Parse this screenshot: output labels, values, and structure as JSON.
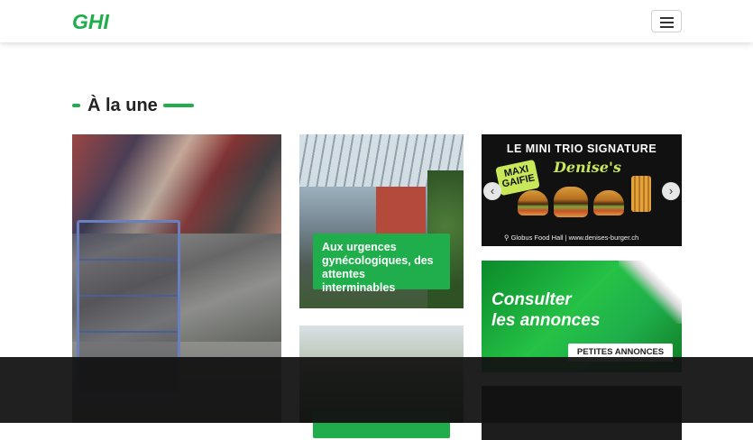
{
  "header": {
    "logo_text": "GHI",
    "brand_color": "#1fae4b",
    "menu_icon": "hamburger-icon"
  },
  "section": {
    "title": "À la une"
  },
  "articles": [
    {
      "caption": "Aux urgences gynécologiques, des attentes interminables"
    },
    {
      "caption": ""
    }
  ],
  "ads": {
    "burger": {
      "title": "LE MINI TRIO SIGNATURE",
      "brand": "Denise's",
      "badge": "MAXI GAIFIE",
      "footer": "⚲ Globus Food Hall  |  www.denises-burger.ch",
      "prev_icon": "chevron-left-icon",
      "next_icon": "chevron-right-icon"
    },
    "petites": {
      "headline_line1": "Consulter",
      "headline_line2": "les annonces",
      "button_label": "PETITES ANNONCES"
    }
  }
}
